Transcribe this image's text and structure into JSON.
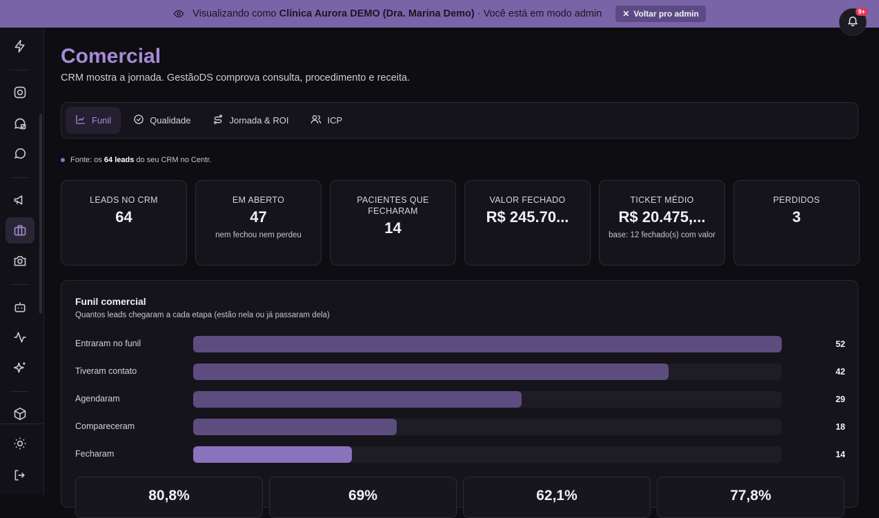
{
  "banner": {
    "prefix": "Visualizando como",
    "clinic": "Clínica Aurora DEMO (Dra. Marina Demo)",
    "suffix": "· Você está em modo admin",
    "exit_label": "Voltar pro admin"
  },
  "notifications": {
    "badge": "9+"
  },
  "sidebar": {
    "logo": "c"
  },
  "page": {
    "title": "Comercial",
    "subtitle": "CRM mostra a jornada. GestãoDS comprova consulta, procedimento e receita."
  },
  "tabs": [
    {
      "label": "Funil",
      "icon": "chart-line-icon",
      "active": true
    },
    {
      "label": "Qualidade",
      "icon": "check-circle-icon",
      "active": false
    },
    {
      "label": "Jornada & ROI",
      "icon": "route-icon",
      "active": false
    },
    {
      "label": "ICP",
      "icon": "users-icon",
      "active": false
    }
  ],
  "source": {
    "prefix": "Fonte: os",
    "bold": "64 leads",
    "suffix": "do seu CRM no Centr."
  },
  "kpis": [
    {
      "label": "LEADS NO CRM",
      "value": "64",
      "note": ""
    },
    {
      "label": "EM ABERTO",
      "value": "47",
      "note": "nem fechou nem perdeu"
    },
    {
      "label": "PACIENTES QUE FECHARAM",
      "value": "14",
      "note": ""
    },
    {
      "label": "VALOR FECHADO",
      "value": "R$ 245.70...",
      "note": ""
    },
    {
      "label": "TICKET MÉDIO",
      "value": "R$ 20.475,...",
      "note": "base: 12 fechado(s) com valor"
    },
    {
      "label": "PERDIDOS",
      "value": "3",
      "note": ""
    }
  ],
  "funnel": {
    "title": "Funil comercial",
    "subtitle": "Quantos leads chegaram a cada etapa (estão nela ou já passaram dela)",
    "max": 52,
    "rows": [
      {
        "label": "Entraram no funil",
        "value": 52
      },
      {
        "label": "Tiveram contato",
        "value": 42
      },
      {
        "label": "Agendaram",
        "value": 29
      },
      {
        "label": "Compareceram",
        "value": 18
      },
      {
        "label": "Fecharam",
        "value": 14
      }
    ],
    "rates": [
      "80,8%",
      "69%",
      "62,1%",
      "77,8%"
    ]
  },
  "colors": {
    "accent": "#a58bd6",
    "banner": "#7a64a8",
    "bar": "#5d4c80",
    "bar_highlight": "#8a72bd"
  }
}
